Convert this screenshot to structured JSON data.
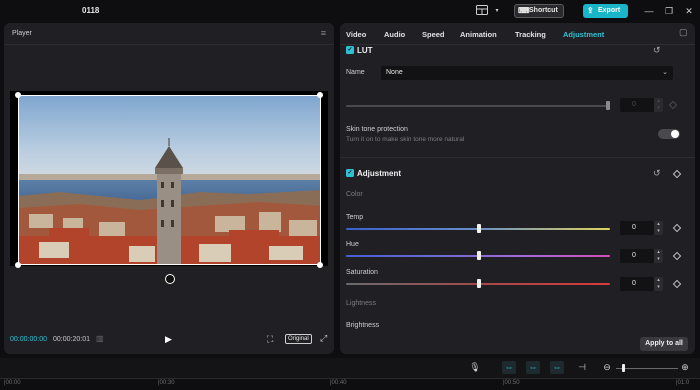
{
  "app": {
    "project_title": "0118",
    "shortcut_label": "Shortcut",
    "export_label": "Export",
    "icons": [
      "layout-icon",
      "keyboard-icon",
      "export-upload-icon",
      "minimize-icon",
      "maximize-icon",
      "close-icon"
    ]
  },
  "player": {
    "title": "Player",
    "time_current": "00:00:00:00",
    "time_total": "00:00:20:01",
    "original_label": "Original"
  },
  "tabs": [
    {
      "label": "Video",
      "active": false
    },
    {
      "label": "Audio",
      "active": false
    },
    {
      "label": "Speed",
      "active": false
    },
    {
      "label": "Animation",
      "active": false
    },
    {
      "label": "Tracking",
      "active": false
    },
    {
      "label": "Adjustment",
      "active": true
    }
  ],
  "lut": {
    "title": "LUT",
    "checked": true,
    "name_label": "Name",
    "name_value": "None",
    "intensity_value": "0",
    "skin_tone_label": "Skin tone protection",
    "skin_tone_hint": "Turn it on to make skin tone more natural",
    "skin_tone_enabled": false
  },
  "adjustment": {
    "title": "Adjustment",
    "checked": true,
    "color_heading": "Color",
    "sliders": [
      {
        "label": "Temp",
        "value": "0"
      },
      {
        "label": "Hue",
        "value": "0"
      },
      {
        "label": "Saturation",
        "value": "0"
      }
    ],
    "lightness_heading": "Lightness",
    "brightness_label": "Brightness",
    "apply_all_label": "Apply to all"
  },
  "timeline": {
    "ticks": [
      "|00:00",
      "|00:30",
      "|00:40",
      "|00:50",
      "|01:0"
    ]
  },
  "colors": {
    "accent": "#2fc1d3",
    "export": "#19b5c8",
    "panel": "#202024",
    "background": "#0e0e10"
  }
}
